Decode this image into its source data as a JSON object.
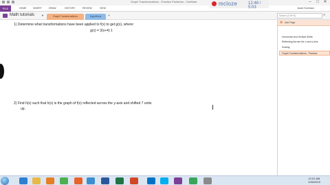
{
  "window": {
    "title": "Graph Transformations - Practice Problems - OneNote",
    "controls": {
      "minimize": "–",
      "maximize": "□",
      "close": "✕"
    }
  },
  "recording": {
    "label": "mcloze",
    "time": "12:48 / 5:03"
  },
  "ribbon": {
    "file": "FILE",
    "tabs": [
      "HOME",
      "INSERT",
      "DRAW",
      "HISTORY",
      "REVIEW",
      "VIEW"
    ],
    "user": "Jacob Sorenson"
  },
  "notebook": {
    "name": "Math tutorials",
    "sections": [
      {
        "label": "Graph Transformations",
        "color": "#f4b183"
      },
      {
        "label": "Algorithms",
        "color": "#8fbbe8"
      }
    ],
    "search_placeholder": "Search (Ctrl+E)"
  },
  "page": {
    "q1_line1": "1)   Determine what transformations have been applied to f(x) to get g(x), where:",
    "q1_formula": "g(x) = 3(x+4) 1",
    "q2_line1": "2)   Find h(x) such that h(x) is the graph of f(x) reflected across the y-axis and shifted 7 units",
    "q2_line2": "up."
  },
  "panel": {
    "add_page": "Add Page",
    "pages": [
      "Horizontal and Vertical Shifts",
      "Reflecting Across the x and y Axis",
      "Scaling",
      "Graph Transformations - Practice"
    ]
  },
  "taskbar": {
    "apps": [
      {
        "name": "ie-icon",
        "color": "#2f7fd0"
      },
      {
        "name": "folder-icon",
        "color": "#e8b948"
      },
      {
        "name": "media-icon",
        "color": "#e67e22"
      },
      {
        "name": "chrome-icon",
        "color": "#4caf50"
      },
      {
        "name": "firefox-icon",
        "color": "#e8632a"
      },
      {
        "name": "photo-icon",
        "color": "#3d8ed1"
      },
      {
        "name": "word-icon",
        "color": "#2b579a"
      },
      {
        "name": "excel-icon",
        "color": "#217346"
      },
      {
        "name": "powerpoint-icon",
        "color": "#d24726"
      },
      {
        "name": "outlook-icon",
        "color": "#0072c6"
      },
      {
        "name": "skype-icon",
        "color": "#00aff0"
      },
      {
        "name": "onenote-icon",
        "color": "#7b3f96"
      },
      {
        "name": "camtasia-icon",
        "color": "#3aa55a"
      },
      {
        "name": "tool-icon",
        "color": "#8a8a8a"
      }
    ],
    "time": "12:01 AM",
    "date": "1/26/2015"
  }
}
